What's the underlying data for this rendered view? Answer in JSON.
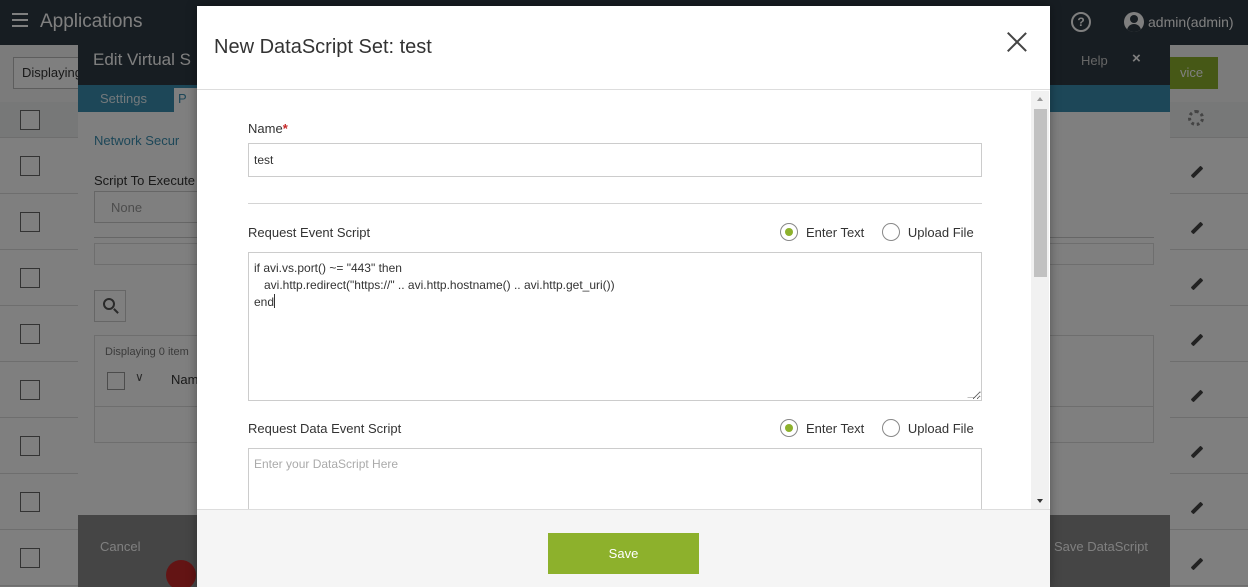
{
  "app": {
    "title": "Applications",
    "user": "admin(admin)",
    "displaying_label": "Displaying",
    "create_label": "vice"
  },
  "vs_modal": {
    "title": "Edit Virtual S",
    "help": "Help",
    "close": "×",
    "tab_settings": "Settings",
    "tab_partial": "P",
    "link": "Network Secur",
    "script_label": "Script To Execute",
    "select_value": "None",
    "displaying": "Displaying 0 item",
    "name_col": "Nam",
    "cancel": "Cancel",
    "save_datascript": "Save DataScript"
  },
  "dialog": {
    "title": "New DataScript Set: test",
    "name_label": "Name",
    "name_value": "test",
    "request_event": {
      "label": "Request Event Script",
      "enter_text": "Enter Text",
      "upload_file": "Upload File",
      "selected": "enter",
      "script_lines": [
        "if avi.vs.port() ~= \"443\" then",
        "   avi.http.redirect(\"https://\" .. avi.http.hostname() .. avi.http.get_uri())",
        "end"
      ]
    },
    "request_data_event": {
      "label": "Request Data Event Script",
      "enter_text": "Enter Text",
      "upload_file": "Upload File",
      "selected": "enter",
      "placeholder": "Enter your DataScript Here"
    },
    "save_label": "Save"
  },
  "colors": {
    "accent_green": "#8db12c",
    "header_dark": "#2f3a44",
    "tab_blue": "#3b8fb1",
    "required_red": "#c62828"
  }
}
